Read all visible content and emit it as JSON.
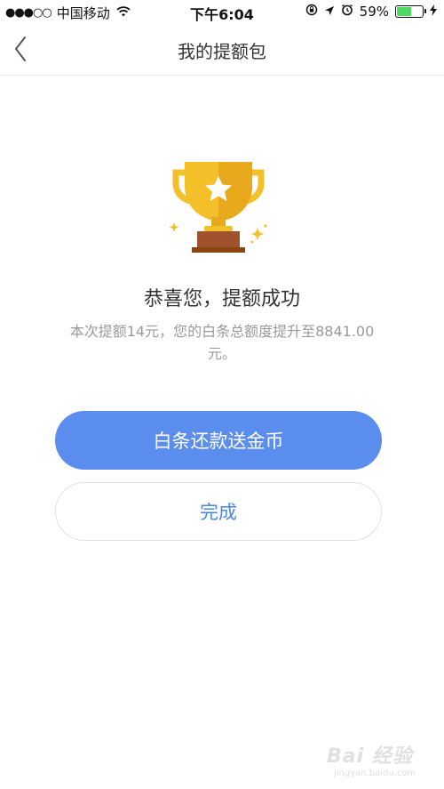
{
  "status_bar": {
    "carrier": "中国移动",
    "signal": "●●●○○",
    "time": "下午6:04",
    "battery_percent": "59%",
    "battery_level": 0.59,
    "battery_color": "#4cd964"
  },
  "nav": {
    "back_icon": "chevron-left-icon",
    "title": "我的提额包"
  },
  "result": {
    "icon": "trophy-icon",
    "title": "恭喜您，提额成功",
    "description": "本次提额14元，您的白条总额度提升至8841.00元。"
  },
  "actions": {
    "primary_label": "白条还款送金币",
    "secondary_label": "完成"
  },
  "watermark": {
    "main": "Bai 经验",
    "sub": "jingyan.baidu.com"
  },
  "colors": {
    "primary": "#5b8def",
    "secondary_text": "#4a86e8",
    "trophy_gold": "#f4c02a",
    "trophy_base": "#a0522d"
  }
}
